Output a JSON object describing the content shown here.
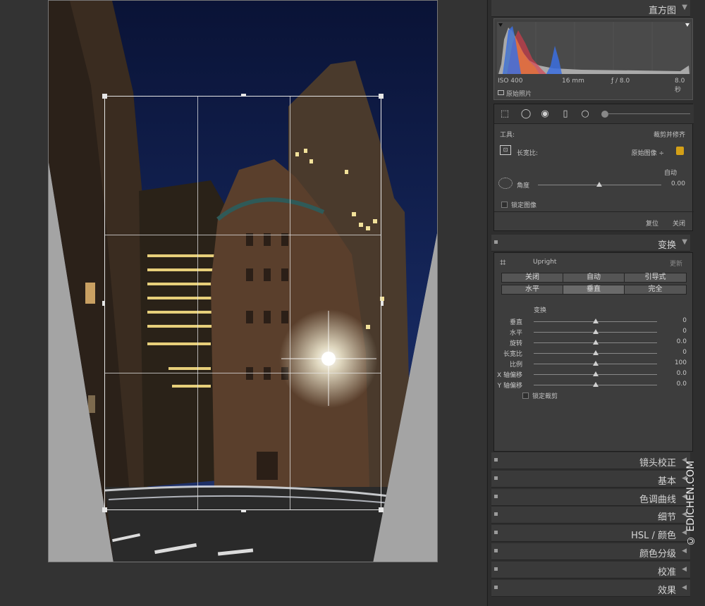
{
  "histogram": {
    "title": "直方图",
    "iso": "ISO 400",
    "focal": "16 mm",
    "aperture": "ƒ / 8.0",
    "shutter": "8.0 秒",
    "original_photo": "原始照片"
  },
  "crop": {
    "tool_label": "工具:",
    "tool_value": "裁剪并修齐",
    "aspect_label": "长宽比:",
    "aspect_value": "原始图像 ÷",
    "auto_label": "自动",
    "angle_label": "角度",
    "angle_value": "0.00",
    "lock_label": "锁定图像",
    "reset_label": "复位",
    "close_label": "关闭"
  },
  "transform": {
    "title": "变换",
    "upright_label": "Upright",
    "update_label": "更新",
    "upright_buttons": [
      "关闭",
      "自动",
      "引导式",
      "水平",
      "垂直",
      "完全"
    ],
    "active_button": "垂直",
    "section_label": "变换",
    "sliders": [
      {
        "label": "垂直",
        "value": "0",
        "level": 0.5
      },
      {
        "label": "水平",
        "value": "0",
        "level": 0.5
      },
      {
        "label": "旋转",
        "value": "0.0",
        "level": 0.5
      },
      {
        "label": "长宽比",
        "value": "0",
        "level": 0.5
      },
      {
        "label": "比例",
        "value": "100",
        "level": 0.5
      },
      {
        "label": "X 轴偏移",
        "value": "0.0",
        "level": 0.5
      },
      {
        "label": "Y 轴偏移",
        "value": "0.0",
        "level": 0.5
      }
    ],
    "lock_crop_label": "锁定裁剪"
  },
  "collapsed_panels": [
    "镜头校正",
    "基本",
    "色调曲线",
    "细节",
    "HSL / 颜色",
    "颜色分级",
    "校准",
    "效果"
  ],
  "watermark": "© EDICHEN.COM",
  "colors": {
    "panel_bg": "#2e2e2e",
    "section_bg": "#3d3d3d",
    "accent_lock": "#d4a017"
  }
}
